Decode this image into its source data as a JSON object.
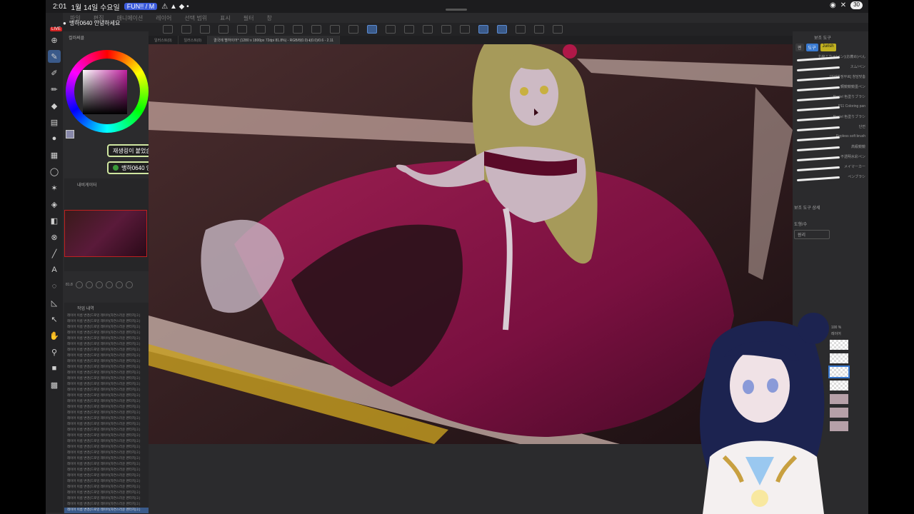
{
  "status_bar": {
    "time": "2:01",
    "date": "1월 14일 수요일",
    "app_badge": "FUN!! / M",
    "battery": "30"
  },
  "menu": [
    "파일",
    "편집",
    "애니메이션",
    "레이어",
    "선택 범위",
    "표시",
    "필터",
    "창"
  ],
  "user_header": {
    "name": "맹하0640 안녕하세요",
    "live_label": "LIVE"
  },
  "color_panel": {
    "tab_label": "컬러써클"
  },
  "chat": [
    {
      "text": "재생링이 붙었습니다."
    },
    {
      "text": "맹하0640  안녕하세요"
    }
  ],
  "navigator": {
    "title": "내비게이터",
    "zoom": "81.8"
  },
  "history": {
    "title": "작업 내역",
    "rows": [
      "레이어 이름 변경(드로잉 레이어(자연스러운 펜터치)ミ)",
      "레이어 이름 변경(드로잉 레이어(자연스러운 펜터치)ミ)",
      "레이어 이름 변경(드로잉 레이어(자연스러운 펜터치)ミ)",
      "레이어 이름 변경(드로잉 레이어(자연스러운 펜터치)ミ)",
      "레이어 이름 변경(드로잉 레이어(자연스러운 펜터치)ミ)",
      "레이어 이름 변경(드로잉 레이어(자연스러운 펜터치)ミ)",
      "레이어 이름 변경(드로잉 레이어(자연스러운 펜터치)ミ)",
      "레이어 이름 변경(드로잉 레이어(자연스러운 펜터치)ミ)",
      "레이어 이름 변경(드로잉 레이어(자연스러운 펜터치)ミ)",
      "레이어 이름 변경(드로잉 레이어(자연스러운 펜터치)ミ)",
      "레이어 이름 변경(드로잉 레이어(자연스러운 펜터치)ミ)",
      "레이어 이름 변경(드로잉 레이어(자연스러운 펜터치)ミ)",
      "레이어 이름 변경(드로잉 레이어(자연스러운 펜터치)ミ)",
      "레이어 이름 변경(드로잉 레이어(자연스러운 펜터치)ミ)",
      "레이어 이름 변경(드로잉 레이어(자연스러운 펜터치)ミ)",
      "레이어 이름 변경(드로잉 레이어(자연스러운 펜터치)ミ)",
      "레이어 이름 변경(드로잉 레이어(자연스러운 펜터치)ミ)",
      "레이어 이름 변경(드로잉 레이어(자연스러운 펜터치)ミ)",
      "레이어 이름 변경(드로잉 레이어(자연스러운 펜터치)ミ)",
      "레이어 이름 변경(드로잉 레이어(자연스러운 펜터치)ミ)",
      "레이어 이름 변경(드로잉 레이어(자연스러운 펜터치)ミ)",
      "레이어 이름 변경(드로잉 레이어(자연스러운 펜터치)ミ)",
      "레이어 이름 변경(드로잉 레이어(자연스러운 펜터치)ミ)",
      "레이어 이름 변경(드로잉 레이어(자연스러운 펜터치)ミ)",
      "레이어 이름 변경(드로잉 레이어(자연스러운 펜터치)ミ)",
      "레이어 이름 변경(드로잉 레이어(자연스러운 펜터치)ミ)",
      "레이어 이름 변경(드로잉 레이어(자연스러운 펜터치)ミ)",
      "레이어 이름 변경(드로잉 레이어(자연스러운 펜터치)ミ)",
      "레이어 이름 변경(드로잉 레이어(자연스러운 펜터치)ミ)",
      "레이어 이름 변경(드로잉 레이어(자연스러운 펜터치)ミ)",
      "레이어 이름 변경(드로잉 레이어(자연스러운 펜터치)ミ)",
      "레이어 이름 변경(드로잉 레이어(자연스러운 펜터치)ミ)",
      "레이어 이름 변경(드로잉 레이어(자연스러운 펜터치)ミ)",
      "레이어 이름 변경(드로잉 레이어(자연스러운 펜터치)ミ)",
      "레이어 이름 변경(드로잉 레이어(자연스러운 펜터치)ミ)"
    ]
  },
  "doc_tabs": [
    {
      "label": "일러스트(0)"
    },
    {
      "label": "일러스트(0)"
    },
    {
      "label": "결국에 별하이어* (1280 x 1800px 72dpi 81.8%) - RGB/8(0.0)-ℹ(0.0)/0.6 - 2.11",
      "active": true
    }
  ],
  "right_panel": {
    "tabs": [
      {
        "label": "펜"
      },
      {
        "label": "도구",
        "active": true
      },
      {
        "label": "Jurish"
      }
    ],
    "brush_list_header": "보조 도구",
    "brushes": [
      "主線ミカメ(ペン)(お薦め)ぺん",
      "スム!ペン",
      "[기간한정무료] 청담맞춤",
      "鋼鏡鏡鏡墨ペン",
      "Pastel 色塗りブラシ",
      "P11 Coloring pan",
      "Pastel 色塗りブラシ",
      "단면",
      "Pepless soft brush",
      "高級鏡鏡",
      "不透明水彩ペン",
      "メイマーカー",
      "ペンブラシ"
    ],
    "props_title": "보조 도구 상세",
    "props_label": "도형/수",
    "props_value": "원리"
  },
  "layers": {
    "opacity_label": "100 %",
    "layer_name": "레이어"
  },
  "colors": {
    "accent_blue": "#3a7ad0",
    "chat_border": "#cfe6a0",
    "live_red": "#d02020",
    "dress_crimson": "#8a1a48"
  },
  "icons": {
    "tools": [
      "magnifier-icon",
      "pen-icon",
      "brush-icon",
      "pencil-icon",
      "eraser-icon",
      "fill-icon",
      "blend-icon",
      "gradient-icon",
      "lasso-icon",
      "move-icon",
      "text-icon",
      "ruler-icon",
      "hand-icon",
      "eyedropper-icon"
    ]
  }
}
